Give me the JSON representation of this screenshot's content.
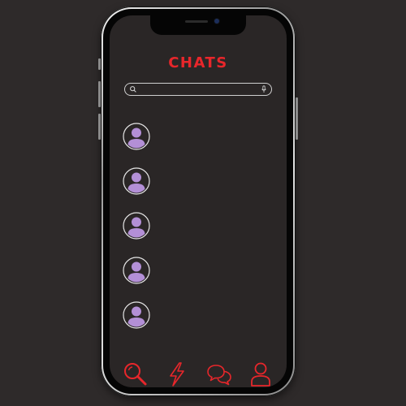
{
  "screen": {
    "title": "CHATS"
  },
  "search": {
    "value": "",
    "placeholder": ""
  },
  "chats": [
    {
      "avatar_icon": "user-avatar-icon"
    },
    {
      "avatar_icon": "user-avatar-icon"
    },
    {
      "avatar_icon": "user-avatar-icon"
    },
    {
      "avatar_icon": "user-avatar-icon"
    },
    {
      "avatar_icon": "user-avatar-icon"
    }
  ],
  "tab_bar": {
    "items": [
      {
        "icon": "search-icon"
      },
      {
        "icon": "lightning-icon"
      },
      {
        "icon": "chat-bubbles-icon"
      },
      {
        "icon": "profile-icon"
      }
    ]
  },
  "colors": {
    "accent": "#e8262b",
    "avatar": "#b38fd6",
    "background": "#2e2a2a",
    "screen": "#2a2626"
  }
}
